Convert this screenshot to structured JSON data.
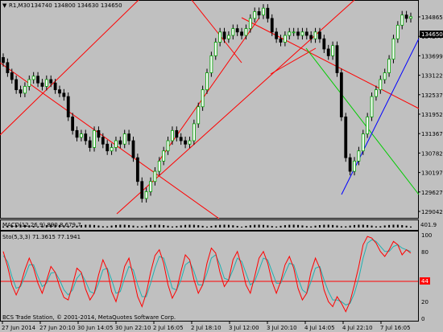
{
  "header": {
    "symbol_label": "R1,M30",
    "quote_values": "134740 134800 134630 134650"
  },
  "price_axis": {
    "ticks": [
      "134865",
      "134277",
      "133699",
      "133122",
      "132537",
      "131952",
      "131367",
      "130782",
      "130197",
      "129627",
      "129042"
    ],
    "last_price": "134650"
  },
  "macd_panel": {
    "label": "MACD(12,26,9) 890.8 679.7",
    "axis_ticks": [
      "401.9",
      "0"
    ]
  },
  "stoch_panel": {
    "label": "Sto(5,3,3) 71.3615 77.1941",
    "axis_ticks": [
      "100",
      "80",
      "44",
      "20",
      "0"
    ],
    "level_value": "44"
  },
  "footer": {
    "copyright": "BCS Trade Station, © 2001-2014, MetaQuotes Software Corp."
  },
  "time_axis": {
    "labels": [
      "27 Jun 2014",
      "27 Jun 20:10",
      "30 Jun 14:05",
      "30 Jun 22:10",
      "2 Jul 16:05",
      "2 Jul 18:10",
      "3 Jul 12:00",
      "3 Jul 20:10",
      "4 Jul 14:05",
      "4 Jul 22:10",
      "7 Jul 16:05"
    ]
  },
  "colors": {
    "background": "#c0c0c0",
    "candle_up": "#00a000",
    "candle_down": "#000000",
    "trendline": "#ff0000",
    "channel_line": "#0000ff",
    "green_line": "#00cc00",
    "stoch_main": "#ff0000",
    "stoch_signal": "#20b0b0",
    "price_marker_bg": "#000000"
  },
  "chart_data": {
    "type": "candlestick",
    "price_range": [
      128800,
      135000
    ],
    "stoch_range": [
      0,
      100
    ],
    "stoch_level": 44,
    "close": [
      133300,
      133000,
      132800,
      132500,
      132400,
      132600,
      132800,
      132900,
      132700,
      132600,
      132800,
      132700,
      132500,
      132400,
      132300,
      131700,
      131300,
      131100,
      131200,
      131000,
      130800,
      131300,
      131100,
      130900,
      130700,
      130800,
      131000,
      130900,
      131200,
      131000,
      130500,
      129800,
      129300,
      129500,
      129800,
      130100,
      130400,
      130700,
      131000,
      131300,
      131100,
      131000,
      130900,
      131000,
      131500,
      132000,
      132500,
      133000,
      133500,
      133900,
      134200,
      134000,
      134100,
      134300,
      134200,
      134100,
      134300,
      134600,
      134800,
      134700,
      134900,
      134600,
      134200,
      134000,
      133900,
      134100,
      134200,
      134200,
      134100,
      134200,
      134100,
      134000,
      134200,
      134000,
      133700,
      133500,
      133800,
      133000,
      131700,
      130500,
      130100,
      130400,
      130700,
      131200,
      131700,
      132300,
      132500,
      132800,
      133000,
      133400,
      134000,
      134400,
      134700,
      134600,
      134650
    ],
    "stoch_main": [
      80,
      62,
      40,
      28,
      40,
      58,
      72,
      60,
      42,
      30,
      45,
      62,
      55,
      38,
      25,
      22,
      40,
      60,
      55,
      35,
      22,
      30,
      52,
      70,
      58,
      32,
      20,
      38,
      62,
      72,
      50,
      26,
      14,
      30,
      55,
      75,
      82,
      66,
      40,
      24,
      34,
      56,
      76,
      70,
      46,
      30,
      40,
      66,
      84,
      78,
      55,
      38,
      46,
      70,
      80,
      62,
      40,
      30,
      50,
      72,
      80,
      66,
      44,
      30,
      44,
      64,
      74,
      60,
      36,
      22,
      30,
      56,
      72,
      60,
      34,
      20,
      14,
      26,
      18,
      8,
      20,
      40,
      62,
      88,
      98,
      96,
      90,
      80,
      74,
      82,
      92,
      88,
      76,
      82,
      78
    ],
    "stoch_signal": [
      75,
      68,
      50,
      36,
      38,
      50,
      64,
      64,
      50,
      38,
      42,
      54,
      55,
      46,
      34,
      28,
      34,
      48,
      54,
      44,
      32,
      30,
      42,
      58,
      60,
      46,
      30,
      32,
      48,
      62,
      58,
      40,
      26,
      26,
      42,
      60,
      74,
      72,
      54,
      36,
      34,
      46,
      64,
      68,
      56,
      40,
      40,
      54,
      72,
      76,
      64,
      48,
      46,
      58,
      72,
      68,
      54,
      40,
      44,
      58,
      72,
      70,
      56,
      42,
      42,
      54,
      66,
      64,
      48,
      34,
      30,
      44,
      60,
      62,
      46,
      32,
      22,
      22,
      20,
      16,
      18,
      30,
      48,
      72,
      90,
      94,
      92,
      86,
      80,
      80,
      86,
      88,
      84,
      82,
      80
    ]
  }
}
